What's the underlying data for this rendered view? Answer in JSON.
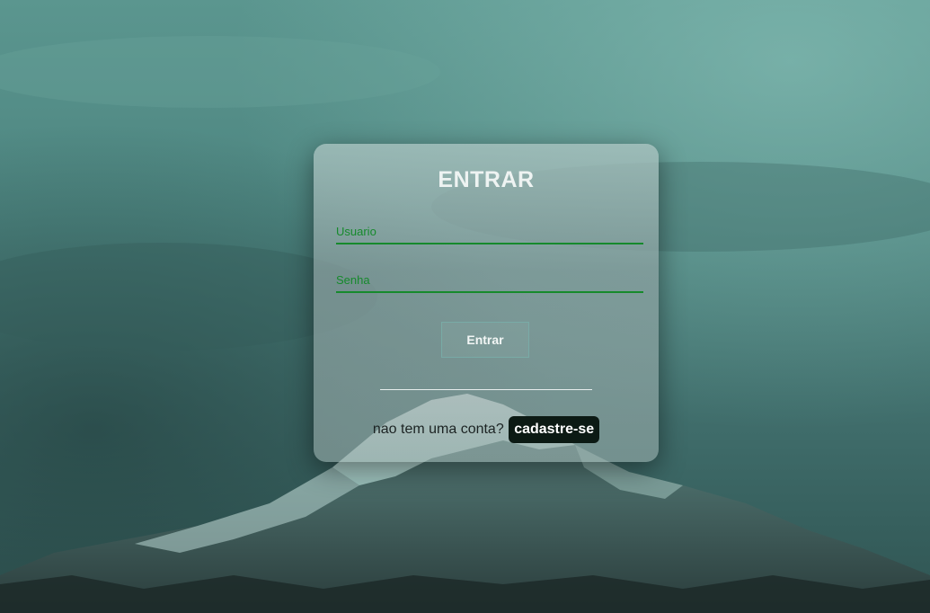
{
  "login": {
    "title": "ENTRAR",
    "username_placeholder": "Usuario",
    "username_value": "",
    "password_placeholder": "Senha",
    "password_value": "",
    "submit_label": "Entrar",
    "no_account_text": "nao tem uma conta?",
    "signup_label": "cadastre-se"
  },
  "colors": {
    "accent_green": "#168a2c",
    "signup_badge": "#0c1a14",
    "background_teal": "#4f8a84"
  }
}
